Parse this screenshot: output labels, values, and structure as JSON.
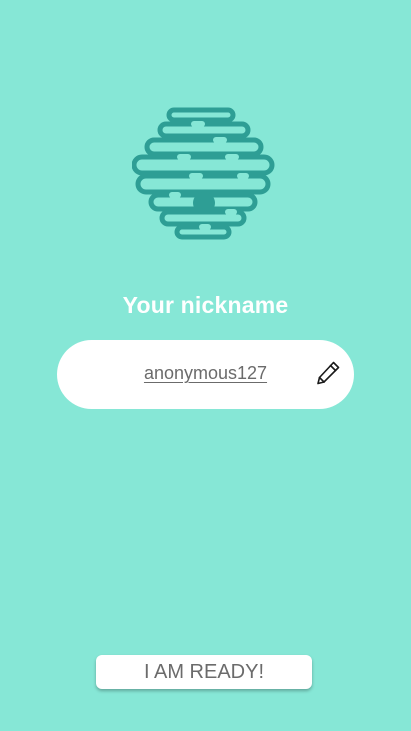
{
  "colors": {
    "background": "#86e7d6",
    "logo": "#2e9e95",
    "text_light": "#ffffff",
    "text_muted": "#6b6b6b"
  },
  "icons": {
    "logo": "beehive-icon",
    "edit": "pencil-icon"
  },
  "screen": {
    "title": "Your nickname"
  },
  "nickname": {
    "value": "anonymous127"
  },
  "actions": {
    "ready_label": "I AM READY!"
  }
}
